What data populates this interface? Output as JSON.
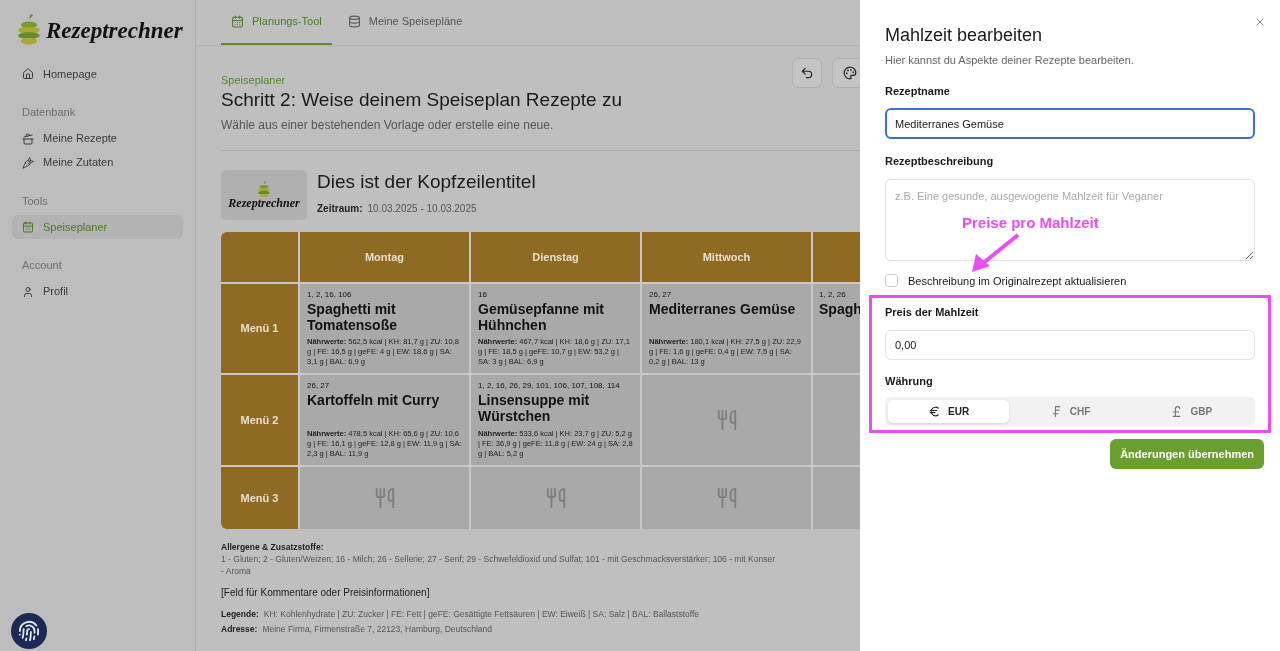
{
  "brand": {
    "logo_text": "Rezeptrechner"
  },
  "sidebar": {
    "items": [
      {
        "kind": "link",
        "label": "Homepage",
        "selected": false
      },
      {
        "kind": "section",
        "label": "Datenbank"
      },
      {
        "kind": "link",
        "label": "Meine Rezepte",
        "selected": false
      },
      {
        "kind": "link",
        "label": "Meine Zutaten",
        "selected": false
      },
      {
        "kind": "section",
        "label": "Tools"
      },
      {
        "kind": "link",
        "label": "Speiseplaner",
        "selected": true
      },
      {
        "kind": "section",
        "label": "Account"
      },
      {
        "kind": "link",
        "label": "Profil",
        "selected": false
      }
    ]
  },
  "tabs": [
    {
      "label": "Planungs-Tool",
      "selected": true
    },
    {
      "label": "Meine Speisepläne",
      "selected": false
    }
  ],
  "page": {
    "breadcrumb": "Speiseplaner",
    "title": "Schritt 2: Weise deinem Speiseplan Rezepte zu",
    "subtitle": "Wähle aus einer bestehenden Vorlage oder erstelle eine neue."
  },
  "plan": {
    "logo_text": "Rezeptrechner",
    "title": "Dies ist der Kopfzeilentitel",
    "period_label": "Zeitraum:",
    "period": "10.03.2025 - 10.03.2025"
  },
  "table": {
    "columns": [
      "Montag",
      "Dienstag",
      "Mittwoch"
    ],
    "rows": [
      {
        "label": "Menü 1",
        "cells": [
          {
            "kind": "meal",
            "allergens": "1, 2, 16, 106",
            "name": "Spaghetti mit Tomatensoße",
            "nutrition_label": "Nährwerte:",
            "nutrition": "562,5 kcal | KH: 81,7 g | ZU: 10,8 g | FE: 16,5 g | geFE: 4 g | EW: 18,6 g | SA: 3,1 g | BAL: 6,9 g"
          },
          {
            "kind": "meal",
            "allergens": "16",
            "name": "Gemüsepfanne mit Hühnchen",
            "nutrition_label": "Nährwerte:",
            "nutrition": "467,7 kcal | KH: 18,6 g | ZU: 17,1 g | FE: 18,5 g | geFE: 10,7 g | EW: 53,2 g | SA: 3 g | BAL: 6,9 g"
          },
          {
            "kind": "meal",
            "allergens": "26, 27",
            "name": "Mediterranes Gemüse",
            "nutrition_label": "Nährwerte:",
            "nutrition": "180,1 kcal | KH: 27,5 g | ZU: 22,9 g | FE: 1,6 g | geFE: 0,4 g | EW: 7,5 g | SA: 0,2 g | BAL: 13 g"
          },
          {
            "kind": "partial",
            "allergens": "1, 2, 26",
            "name": "Spagh"
          }
        ]
      },
      {
        "label": "Menü 2",
        "cells": [
          {
            "kind": "meal",
            "allergens": "26, 27",
            "name": "Kartoffeln mit Curry",
            "nutrition_label": "Nährwerte:",
            "nutrition": "478,5 kcal | KH: 65,6 g | ZU: 10,6 g | FE: 16,1 g | geFE: 12,8 g | EW: 11,9 g | SA: 2,3 g | BAL: 11,9 g"
          },
          {
            "kind": "meal",
            "allergens": "1, 2, 16, 26, 29, 101, 106, 107, 108, 114",
            "name": "Linsensuppe mit Würstchen",
            "nutrition_label": "Nährwerte:",
            "nutrition": "533,6 kcal | KH: 23,7 g | ZU: 5,2 g | FE: 36,9 g | geFE: 11,8 g | EW: 24 g | SA: 2,8 g | BAL: 5,2 g"
          },
          {
            "kind": "empty"
          },
          {
            "kind": "blank"
          }
        ]
      },
      {
        "label": "Menü 3",
        "cells": [
          {
            "kind": "empty"
          },
          {
            "kind": "empty"
          },
          {
            "kind": "empty"
          },
          {
            "kind": "blank"
          }
        ]
      }
    ]
  },
  "footer": {
    "allergens_heading": "Allergene & Zusatzstoffe:",
    "allergens_lines": [
      "1 - Gluten; 2 - Gluten/Weizen; 16 - Milch; 26 - Sellerie; 27 - Senf; 29 - Schwefeldioxid und Sulfat; 101 - mit Geschmacksverstärker; 106 - mit Konser",
      "- Aroma"
    ],
    "comment": "[Feld für Kommentare oder Preisinformationen]",
    "legend_label": "Legende:",
    "legend": "KH: Kohlenhydrate | ZU: Zucker | FE: Fett | geFE: Gesättigte Fettsäuren | EW: Eiweiß | SA: Salz | BAL: Ballaststoffe",
    "address_label": "Adresse:",
    "address": "Meine Firma, Firmenstraße 7, 22123, Hamburg, Deutschland"
  },
  "dialog": {
    "title": "Mahlzeit bearbeiten",
    "description": "Hier kannst du Aspekte deiner Rezepte bearbeiten.",
    "name_label": "Rezeptname",
    "name_value": "Mediterranes Gemüse",
    "description_label": "Rezeptbeschreibung",
    "description_placeholder": "z.B. Eine gesunde, ausgewogene Mahlzeit für Veganer",
    "checkbox": {
      "label": "Beschreibung im Originalrezept aktualisieren",
      "checked": false
    },
    "price_label": "Preis der Mahlzeit",
    "price_value": "0,00",
    "currency_label": "Währung",
    "currencies": [
      {
        "code": "EUR",
        "selected": true
      },
      {
        "code": "CHF",
        "selected": false
      },
      {
        "code": "GBP",
        "selected": false
      }
    ],
    "submit": "Änderungen übernehmen"
  },
  "annotation": {
    "text": "Preise pro Mahlzeit"
  }
}
